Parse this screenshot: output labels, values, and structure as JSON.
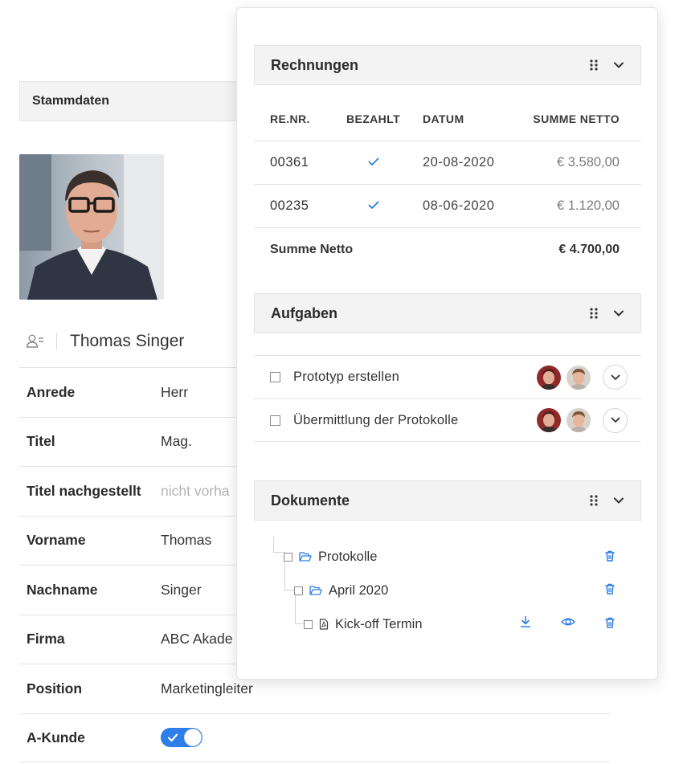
{
  "stammdaten": {
    "header": "Stammdaten",
    "person_name": "Thomas Singer",
    "fields": [
      {
        "label": "Anrede",
        "value": "Herr",
        "muted": false
      },
      {
        "label": "Titel",
        "value": "Mag.",
        "muted": false
      },
      {
        "label": "Titel nachgestellt",
        "value": "nicht vorha",
        "muted": true
      },
      {
        "label": "Vorname",
        "value": "Thomas",
        "muted": false
      },
      {
        "label": "Nachname",
        "value": "Singer",
        "muted": false
      },
      {
        "label": "Firma",
        "value": "ABC Akade",
        "muted": false
      },
      {
        "label": "Position",
        "value": "Marketingleiter",
        "muted": false
      },
      {
        "label": "A-Kunde",
        "value": "",
        "toggle_on": true
      }
    ]
  },
  "rechnungen": {
    "title": "Rechnungen",
    "columns": [
      "RE.NR.",
      "BEZAHLT",
      "DATUM",
      "SUMME NETTO"
    ],
    "rows": [
      {
        "nr": "00361",
        "paid": true,
        "date": "20-08-2020",
        "sum": "€ 3.580,00"
      },
      {
        "nr": "00235",
        "paid": true,
        "date": "08-06-2020",
        "sum": "€ 1.120,00"
      }
    ],
    "total_label": "Summe Netto",
    "total_value": "€ 4.700,00"
  },
  "aufgaben": {
    "title": "Aufgaben",
    "items": [
      {
        "label": "Prototyp erstellen"
      },
      {
        "label": "Übermittlung der Protokolle"
      }
    ]
  },
  "dokumente": {
    "title": "Dokumente",
    "items": [
      {
        "label": "Protokolle",
        "type": "folder"
      },
      {
        "label": "April 2020",
        "type": "folder"
      },
      {
        "label": "Kick-off Termin",
        "type": "pdf"
      }
    ]
  },
  "colors": {
    "accent": "#2d7ee8",
    "header_bg": "#f3f3f3",
    "border": "#e4e4e4"
  },
  "icons": [
    "person-card-icon",
    "check-icon",
    "drag-handle-icon",
    "chevron-down-icon",
    "folder-open-icon",
    "pdf-file-icon",
    "trash-icon",
    "download-icon",
    "eye-icon"
  ]
}
